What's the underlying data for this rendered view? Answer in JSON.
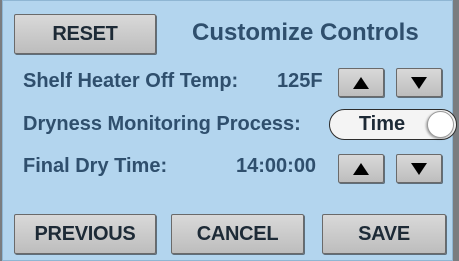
{
  "header": {
    "reset_label": "RESET",
    "title": "Customize Controls"
  },
  "rows": {
    "shelf_heater": {
      "label": "Shelf Heater Off Temp:",
      "value": "125F",
      "up_icon": "triangle-up-icon",
      "down_icon": "triangle-down-icon"
    },
    "dryness": {
      "label": "Dryness Monitoring Process:",
      "toggle_value": "Time"
    },
    "final_dry_time": {
      "label": "Final Dry Time:",
      "value": "14:00:00",
      "up_icon": "triangle-up-icon",
      "down_icon": "triangle-down-icon"
    }
  },
  "footer": {
    "previous_label": "PREVIOUS",
    "cancel_label": "CANCEL",
    "save_label": "SAVE"
  },
  "colors": {
    "panel_bg": "#b3d5ee",
    "text_blue": "#2f4f6d",
    "button_gray": "#cfcfcf"
  }
}
